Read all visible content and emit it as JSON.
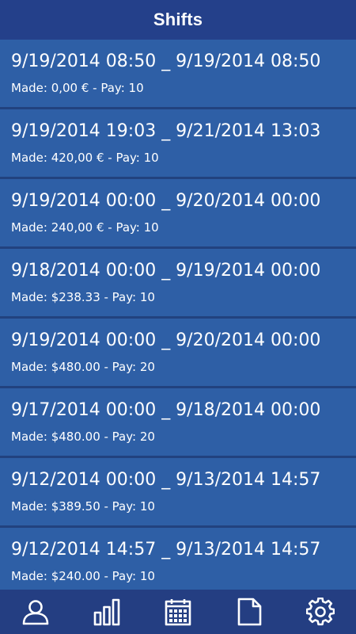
{
  "header": {
    "title": "Shifts"
  },
  "shifts": [
    {
      "range": "9/19/2014 08:50 _ 9/19/2014 08:50",
      "meta": "Made: 0,00 € - Pay: 10"
    },
    {
      "range": "9/19/2014 19:03 _ 9/21/2014 13:03",
      "meta": "Made: 420,00 € - Pay: 10"
    },
    {
      "range": "9/19/2014 00:00 _ 9/20/2014 00:00",
      "meta": "Made: 240,00 € - Pay: 10"
    },
    {
      "range": "9/18/2014 00:00 _ 9/19/2014 00:00",
      "meta": "Made: $238.33 - Pay: 10"
    },
    {
      "range": "9/19/2014 00:00 _ 9/20/2014 00:00",
      "meta": "Made: $480.00 - Pay: 20"
    },
    {
      "range": "9/17/2014 00:00 _ 9/18/2014 00:00",
      "meta": "Made: $480.00 - Pay: 20"
    },
    {
      "range": "9/12/2014 00:00 _ 9/13/2014 14:57",
      "meta": "Made: $389.50 - Pay: 10"
    },
    {
      "range": "9/12/2014 14:57 _ 9/13/2014 14:57",
      "meta": "Made: $240.00 - Pay: 10"
    }
  ],
  "tabbar": {
    "icons": [
      "user-icon",
      "bar-chart-icon",
      "calendar-icon",
      "document-icon",
      "gear-icon"
    ]
  },
  "colors": {
    "header_bg": "#24408a",
    "list_bg": "#2e5fa6",
    "row_divider": "#22427f",
    "tabbar_bg": "#243e82",
    "text": "#ffffff"
  }
}
